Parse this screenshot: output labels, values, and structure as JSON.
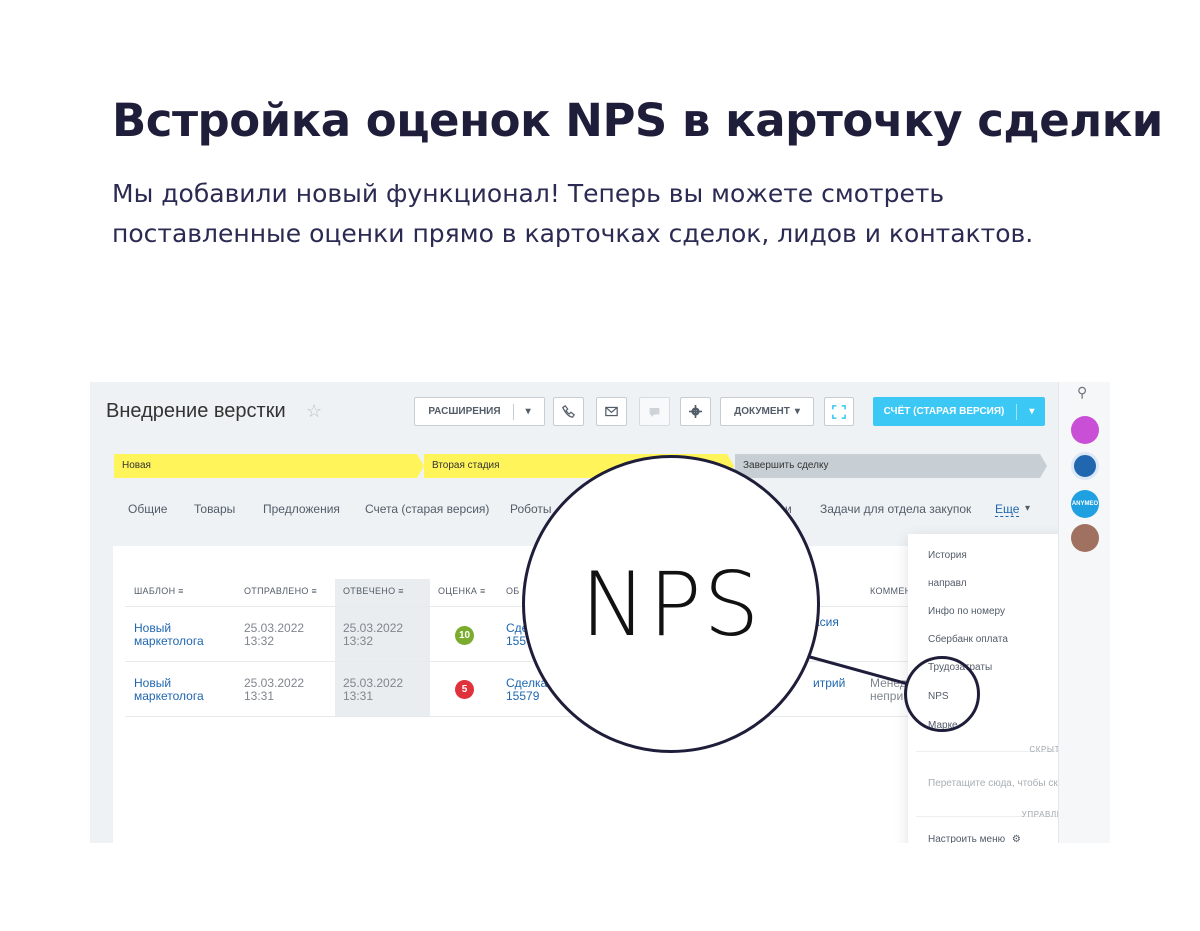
{
  "headline": "Встройка оценок NPS в карточку сделки",
  "subtitle": "Мы добавили новый функционал! Теперь вы можете смотреть поставленные оценки прямо в карточках сделок, лидов и контактов.",
  "deal": {
    "title": "Внедрение верстки"
  },
  "toolbar": {
    "extensions_label": "РАСШИРЕНИЯ",
    "document_label": "ДОКУМЕНТ",
    "invoice_label": "СЧЁТ (СТАРАЯ ВЕРСИЯ)"
  },
  "stages": {
    "new": "Новая",
    "second": "Вторая стадия",
    "finish": "Завершить сделку",
    "colors": {
      "active": "#fff55a",
      "finish": "#c8cfd4"
    }
  },
  "tabs": {
    "general": "Общие",
    "products": "Товары",
    "offers": "Предложения",
    "invoices": "Счета (старая версия)",
    "robots": "Роботы",
    "tasks_partial": "и",
    "purchasing": "Задачи для отдела закупок",
    "more": "Еще"
  },
  "table": {
    "headers": {
      "template": "ШАБЛОН",
      "sent": "ОТПРАВЛЕНО",
      "answered": "ОТВЕЧЕНО",
      "score": "ОЦЕНКА",
      "object_partial": "ОБ",
      "comment_partial": "КОММЕН"
    },
    "rows": [
      {
        "template": "Новый маркетолога",
        "sent_date": "25.03.2022",
        "sent_time": "13:32",
        "answered_date": "25.03.2022",
        "answered_time": "13:32",
        "score": "10",
        "score_color": "#7bac2e",
        "object_line1": "Сдел",
        "object_line2": "155",
        "user_partial": "асия",
        "comment_line1": "",
        "comment_line2": ""
      },
      {
        "template": "Новый маркетолога",
        "sent_date": "25.03.2022",
        "sent_time": "13:31",
        "answered_date": "25.03.2022",
        "answered_time": "13:31",
        "score": "5",
        "score_color": "#e0323c",
        "object_line1": "Сделка",
        "object_line2": "15579",
        "user_partial": "итрий",
        "comment_line1": "Менед",
        "comment_line2": "непри"
      }
    ]
  },
  "menu": {
    "items": {
      "history": "История",
      "direction": "направл",
      "number_info": "Инфо по номеру",
      "sber": "Сбербанк оплата",
      "labor": "Трудозатраты",
      "nps": "NPS",
      "marketing_partial": "Марке"
    },
    "hidden_header": "СКРЫТЫЕ",
    "hint": "Перетащите сюда, чтобы скрыть",
    "manage_header": "УПРАВЛЕНИЕ",
    "configure": "Настроить меню"
  },
  "zoom": {
    "text": "NPS"
  },
  "rail_avatar_labels": {
    "anymeo": "ANYMEO"
  },
  "icons": [
    "star-icon",
    "phone-icon",
    "mail-icon",
    "chat-icon",
    "gear-icon",
    "scan-icon",
    "search-icon",
    "chevron-down-icon"
  ]
}
